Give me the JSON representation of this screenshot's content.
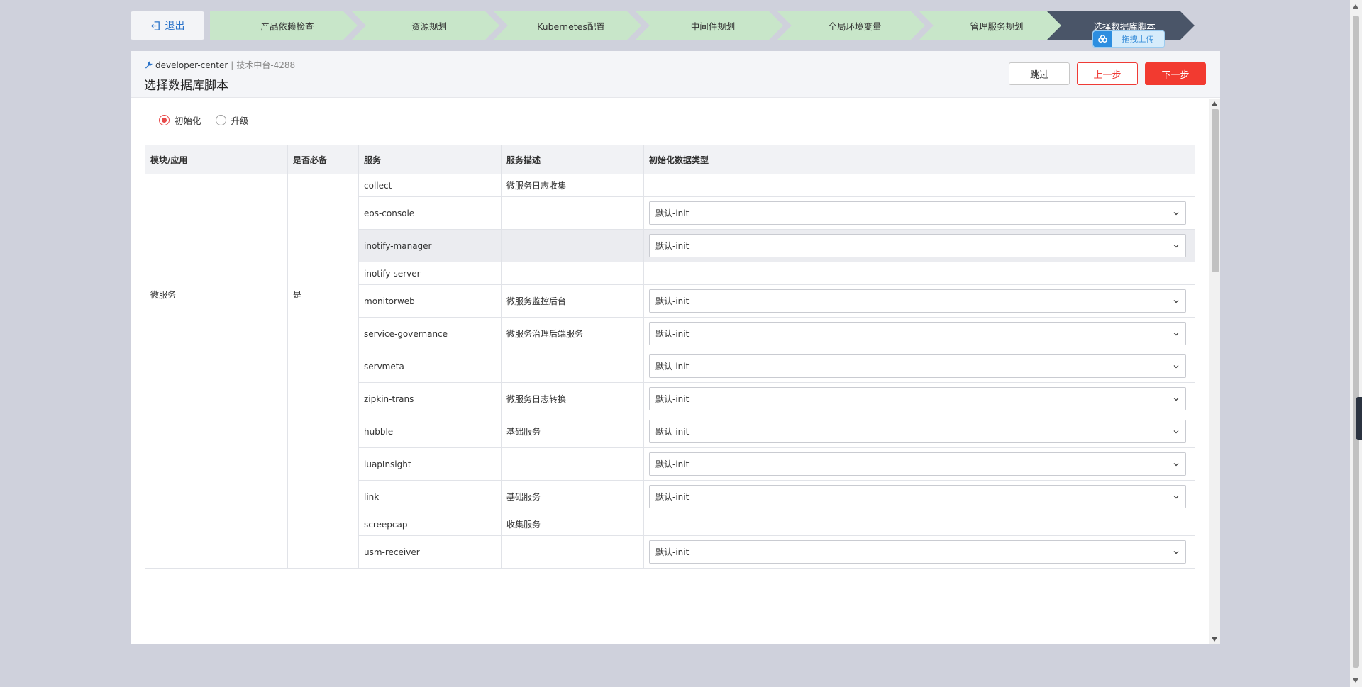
{
  "exit_label": "退出",
  "steps": [
    "产品依赖检查",
    "资源规划",
    "Kubernetes配置",
    "中间件规划",
    "全局环境变量",
    "管理服务规划",
    "选择数据库脚本"
  ],
  "upload_label": "拖拽上传",
  "breadcrumb": {
    "app": "developer-center",
    "separator": "|",
    "tenant": "技术中台-4288"
  },
  "page_title": "选择数据库脚本",
  "buttons": {
    "skip": "跳过",
    "prev": "上一步",
    "next": "下一步"
  },
  "radios": [
    {
      "label": "初始化",
      "checked": true
    },
    {
      "label": "升级",
      "checked": false
    }
  ],
  "table": {
    "columns": [
      "模块/应用",
      "是否必备",
      "服务",
      "服务描述",
      "初始化数据类型"
    ],
    "groups": [
      {
        "module": "微服务",
        "required": "是",
        "rows": [
          {
            "service": "collect",
            "desc": "微服务日志收集",
            "type": "--",
            "select": false
          },
          {
            "service": "eos-console",
            "desc": "",
            "type": "默认-init",
            "select": true
          },
          {
            "service": "inotify-manager",
            "desc": "",
            "type": "默认-init",
            "select": true,
            "highlight": true
          },
          {
            "service": "inotify-server",
            "desc": "",
            "type": "--",
            "select": false
          },
          {
            "service": "monitorweb",
            "desc": "微服务监控后台",
            "type": "默认-init",
            "select": true
          },
          {
            "service": "service-governance",
            "desc": "微服务治理后端服务",
            "type": "默认-init",
            "select": true
          },
          {
            "service": "servmeta",
            "desc": "",
            "type": "默认-init",
            "select": true
          },
          {
            "service": "zipkin-trans",
            "desc": "微服务日志转换",
            "type": "默认-init",
            "select": true
          }
        ]
      },
      {
        "module": "",
        "required": "",
        "rows": [
          {
            "service": "hubble",
            "desc": "基础服务",
            "type": "默认-init",
            "select": true
          },
          {
            "service": "iuapInsight",
            "desc": "",
            "type": "默认-init",
            "select": true
          },
          {
            "service": "link",
            "desc": "基础服务",
            "type": "默认-init",
            "select": true
          },
          {
            "service": "screepcap",
            "desc": "收集服务",
            "type": "--",
            "select": false
          },
          {
            "service": "usm-receiver",
            "desc": "",
            "type": "默认-init",
            "select": true
          }
        ]
      }
    ]
  },
  "colors": {
    "accent_red": "#f23a30",
    "step_done": "#c8e6c9",
    "step_active": "#4a5568",
    "link_blue": "#2a73c9"
  }
}
